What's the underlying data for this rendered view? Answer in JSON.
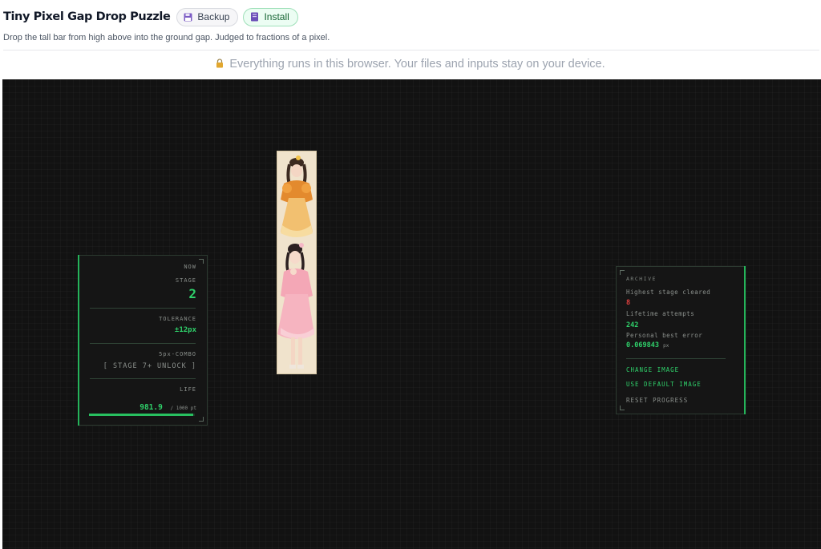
{
  "header": {
    "title": "Tiny Pixel Gap Drop Puzzle",
    "backup_label": "Backup",
    "install_label": "Install",
    "subtitle": "Drop the tall bar from high above into the ground gap. Judged to fractions of a pixel.",
    "privacy_notice": "Everything runs in this browser. Your files and inputs stay on your device."
  },
  "hud": {
    "now_label": "NOW",
    "stage_label": "STAGE",
    "stage_value": "2",
    "tolerance_label": "TOLERANCE",
    "tolerance_value": "±12px",
    "combo_label": "5px-COMBO",
    "combo_status": "[ STAGE 7+ UNLOCK ]",
    "life_label": "LIFE",
    "life_value": "981.9",
    "life_max": "/ 1000 pt",
    "life_fraction": 0.9819
  },
  "archive": {
    "heading": "ARCHIVE",
    "highest_stage_label": "Highest stage cleared",
    "highest_stage_value": "8",
    "lifetime_attempts_label": "Lifetime attempts",
    "lifetime_attempts_value": "242",
    "personal_best_label": "Personal best error",
    "personal_best_value": "0.069843",
    "personal_best_unit": "px",
    "change_image_label": "CHANGE IMAGE",
    "default_image_label": "USE DEFAULT IMAGE",
    "reset_label": "RESET PROGRESS"
  },
  "colors": {
    "accent_green": "#2fd06a",
    "highest_stage_red": "#e0403f",
    "game_background": "#121212",
    "install_pill_bg": "#ecfdf3"
  },
  "icons": {
    "backup": "floppy-disk-icon",
    "install": "book-icon",
    "privacy": "lock-icon"
  }
}
